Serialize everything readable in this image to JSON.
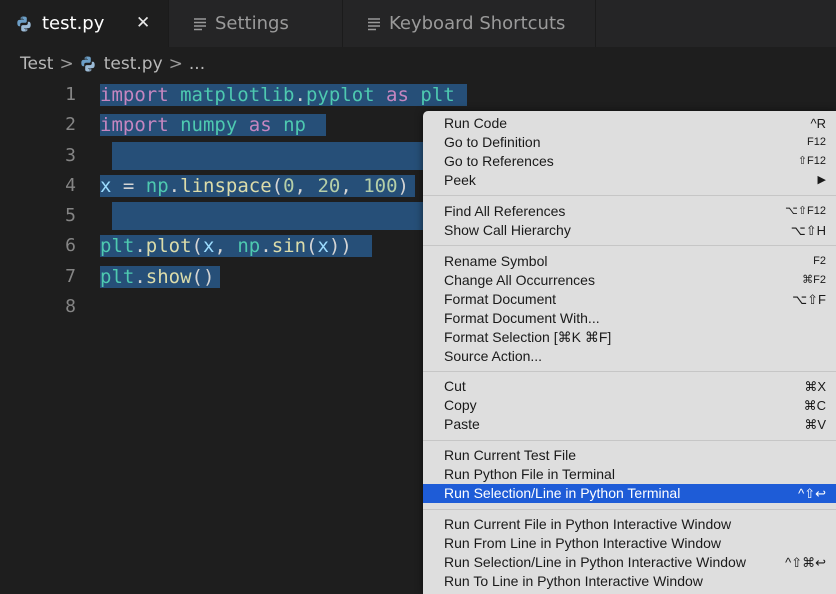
{
  "tabs": [
    {
      "label": "test.py",
      "icon": "python-icon",
      "close": "✕",
      "active": true
    },
    {
      "label": "Settings",
      "icon": "settings-file-icon",
      "active": false
    },
    {
      "label": "Keyboard Shortcuts",
      "icon": "keyboard-shortcuts-file-icon",
      "active": false
    }
  ],
  "breadcrumb": {
    "folder": "Test",
    "sep": ">",
    "file": "test.py",
    "more": "..."
  },
  "line_numbers": [
    "1",
    "2",
    "3",
    "4",
    "5",
    "6",
    "7",
    "8"
  ],
  "code": {
    "l1": {
      "kw1": "import",
      "mod": "matplotlib",
      "dot": ".",
      "sub": "pyplot",
      "kw2": "as",
      "alias": "plt"
    },
    "l2": {
      "kw1": "import",
      "mod": "numpy",
      "kw2": "as",
      "alias": "np"
    },
    "l4": {
      "var": "x",
      "eq": " = ",
      "obj": "np",
      "dot": ".",
      "fn": "linspace",
      "open": "(",
      "a": "0",
      "c1": ", ",
      "b": "20",
      "c2": ", ",
      "c": "100",
      "close": ")"
    },
    "l6": {
      "obj": "plt",
      "dot": ".",
      "fn": "plot",
      "open": "(",
      "arg": "x",
      "comma": ", ",
      "obj2": "np",
      "dot2": ".",
      "fn2": "sin",
      "open2": "(",
      "arg2": "x",
      "close": "))"
    },
    "l7": {
      "obj": "plt",
      "dot": ".",
      "fn": "show",
      "parens": "()"
    }
  },
  "context_menu": {
    "run_code": {
      "label": "Run Code",
      "shortcut": "^R"
    },
    "go_def": {
      "label": "Go to Definition",
      "shortcut": "F12"
    },
    "go_refs": {
      "label": "Go to References",
      "shortcut": "⇧F12"
    },
    "peek": {
      "label": "Peek",
      "shortcut": "▶"
    },
    "find_refs": {
      "label": "Find All References",
      "shortcut": "⌥⇧F12"
    },
    "call_hier": {
      "label": "Show Call Hierarchy",
      "shortcut": "⌥⇧H"
    },
    "rename": {
      "label": "Rename Symbol",
      "shortcut": "F2"
    },
    "change_all": {
      "label": "Change All Occurrences",
      "shortcut": "⌘F2"
    },
    "format_doc": {
      "label": "Format Document",
      "shortcut": "⌥⇧F"
    },
    "format_with": {
      "label": "Format Document With..."
    },
    "format_sel": {
      "label": "Format Selection [⌘K ⌘F]"
    },
    "source_action": {
      "label": "Source Action..."
    },
    "cut": {
      "label": "Cut",
      "shortcut": "⌘X"
    },
    "copy": {
      "label": "Copy",
      "shortcut": "⌘C"
    },
    "paste": {
      "label": "Paste",
      "shortcut": "⌘V"
    },
    "run_test": {
      "label": "Run Current Test File"
    },
    "run_py_term": {
      "label": "Run Python File in Terminal"
    },
    "run_sel_term": {
      "label": "Run Selection/Line in Python Terminal",
      "shortcut": "^⇧↩"
    },
    "run_file_iw": {
      "label": "Run Current File in Python Interactive Window"
    },
    "run_from_iw": {
      "label": "Run From Line in Python Interactive Window"
    },
    "run_sel_iw": {
      "label": "Run Selection/Line in Python Interactive Window",
      "shortcut": "^⇧⌘↩"
    },
    "run_to_iw": {
      "label": "Run To Line in Python Interactive Window"
    }
  },
  "colors": {
    "selection": "#264f78",
    "menu_highlight": "#1e5cd7",
    "keyword": "#c586c0",
    "identifier": "#4ec9b0"
  }
}
